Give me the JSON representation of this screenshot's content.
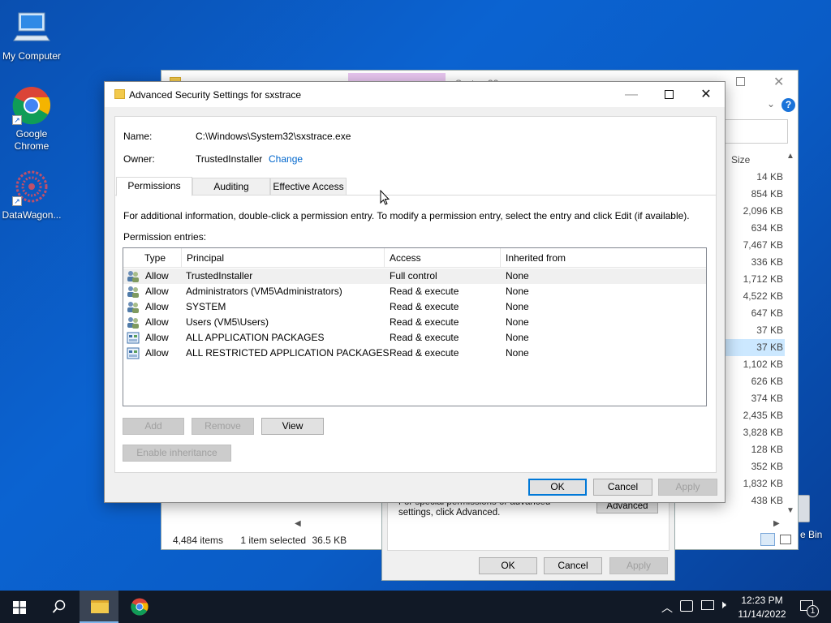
{
  "desktop": {
    "icons": [
      {
        "label": "My Computer"
      },
      {
        "label": "Google Chrome"
      },
      {
        "label": "DataWagon..."
      },
      {
        "label": "e Bin"
      }
    ]
  },
  "explorer": {
    "title_partial": "System32",
    "column_header_size": "Size",
    "sizes": [
      "14 KB",
      "854 KB",
      "2,096 KB",
      "634 KB",
      "7,467 KB",
      "336 KB",
      "1,712 KB",
      "4,522 KB",
      "647 KB",
      "37 KB",
      "37 KB",
      "1,102 KB",
      "626 KB",
      "374 KB",
      "2,435 KB",
      "3,828 KB",
      "128 KB",
      "352 KB",
      "1,832 KB",
      "438 KB"
    ],
    "selected_size_index": 10,
    "status": {
      "items": "4,484 items",
      "selected": "1 item selected",
      "size": "36.5 KB"
    }
  },
  "properties_dialog": {
    "hint": "For special permissions or advanced settings, click Advanced.",
    "advanced_label": "Advanced",
    "ok_label": "OK",
    "cancel_label": "Cancel",
    "apply_label": "Apply"
  },
  "dialog": {
    "title": "Advanced Security Settings for sxstrace",
    "name_label": "Name:",
    "name_value": "C:\\Windows\\System32\\sxstrace.exe",
    "owner_label": "Owner:",
    "owner_value": "TrustedInstaller",
    "change_link": "Change",
    "tabs": [
      {
        "label": "Permissions",
        "active": true
      },
      {
        "label": "Auditing",
        "active": false
      },
      {
        "label": "Effective Access",
        "active": false
      }
    ],
    "info_text": "For additional information, double-click a permission entry. To modify a permission entry, select the entry and click Edit (if available).",
    "entries_label": "Permission entries:",
    "columns": [
      "Type",
      "Principal",
      "Access",
      "Inherited from"
    ],
    "rows": [
      {
        "type": "Allow",
        "principal": "TrustedInstaller",
        "access": "Full control",
        "inherited": "None",
        "icon": "users-icon"
      },
      {
        "type": "Allow",
        "principal": "Administrators (VM5\\Administrators)",
        "access": "Read & execute",
        "inherited": "None",
        "icon": "users-icon"
      },
      {
        "type": "Allow",
        "principal": "SYSTEM",
        "access": "Read & execute",
        "inherited": "None",
        "icon": "users-icon"
      },
      {
        "type": "Allow",
        "principal": "Users (VM5\\Users)",
        "access": "Read & execute",
        "inherited": "None",
        "icon": "users-icon"
      },
      {
        "type": "Allow",
        "principal": "ALL APPLICATION PACKAGES",
        "access": "Read & execute",
        "inherited": "None",
        "icon": "package-icon"
      },
      {
        "type": "Allow",
        "principal": "ALL RESTRICTED APPLICATION PACKAGES",
        "access": "Read & execute",
        "inherited": "None",
        "icon": "package-icon"
      }
    ],
    "add_label": "Add",
    "remove_label": "Remove",
    "view_label": "View",
    "enable_inheritance_label": "Enable inheritance",
    "ok_label": "OK",
    "cancel_label": "Cancel",
    "apply_label": "Apply"
  },
  "taskbar": {
    "time": "12:23 PM",
    "date": "11/14/2022",
    "notification_count": "1"
  },
  "colors": {
    "accent": "#0078d7",
    "link": "#0066cc",
    "taskbar": "#111926"
  }
}
